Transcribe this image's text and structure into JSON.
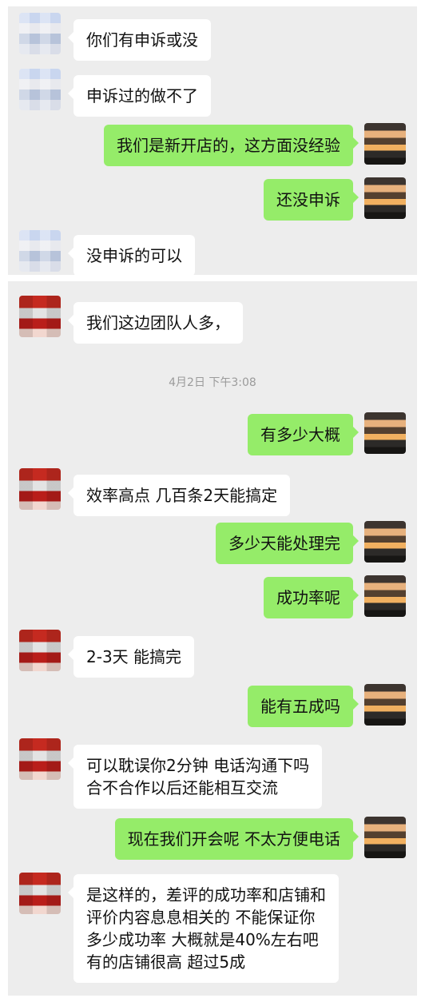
{
  "panel1": {
    "messages": [
      {
        "side": "left",
        "text": "你们有申诉或没"
      },
      {
        "side": "left",
        "text": "申诉过的做不了"
      },
      {
        "side": "right",
        "text": "我们是新开店的，这方面没经验"
      },
      {
        "side": "right",
        "text": "还没申诉"
      },
      {
        "side": "left",
        "text": "没申诉的可以"
      }
    ]
  },
  "panel2": {
    "messages": [
      {
        "side": "left",
        "text": "我们这边团队人多，"
      },
      {
        "side": "right",
        "text": "有多少大概"
      },
      {
        "side": "left",
        "text": "效率高点 几百条2天能搞定"
      },
      {
        "side": "right",
        "text": "多少天能处理完"
      },
      {
        "side": "right",
        "text": "成功率呢"
      },
      {
        "side": "left",
        "text": "2-3天 能搞完"
      },
      {
        "side": "right",
        "text": "能有五成吗"
      },
      {
        "side": "left",
        "text": "可以耽误你2分钟 电话沟通下吗\n合不合作以后还能相互交流"
      },
      {
        "side": "right",
        "text": "现在我们开会呢 不太方便电话"
      },
      {
        "side": "left",
        "text": "是这样的，差评的成功率和店铺和\n评价内容息息相关的 不能保证你\n多少成功率 大概就是40%左右吧\n有的店铺很高 超过5成"
      }
    ],
    "timestamp": "4月2日 下午3:08"
  },
  "colors": {
    "incoming": "#ffffff",
    "outgoing": "#95ec69",
    "chat_bg": "#ededed"
  },
  "icons": {
    "contact_avatar_a": "pixelated-avatar",
    "contact_avatar_b": "pixelated-red-avatar",
    "self_avatar": "sunset-avatar"
  }
}
